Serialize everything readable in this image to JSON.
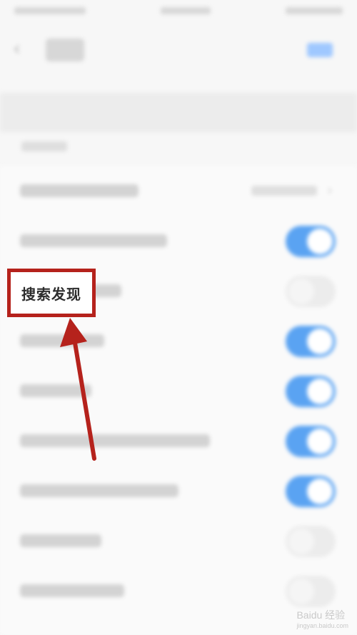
{
  "callout": {
    "label": "搜索发现"
  },
  "watermark": {
    "brand": "Baidu 经验",
    "domain": "jingyan.baidu.com"
  },
  "colors": {
    "accent": "#5aa3f2",
    "highlight": "#b5221c"
  },
  "icons": {
    "back": "chevron-left-icon",
    "row_arrow": "chevron-right-icon"
  },
  "settings": [
    {
      "type": "select"
    },
    {
      "type": "toggle",
      "on": true
    },
    {
      "type": "toggle",
      "on": false
    },
    {
      "type": "toggle",
      "on": true
    },
    {
      "type": "toggle",
      "on": true
    },
    {
      "type": "toggle",
      "on": true
    },
    {
      "type": "toggle",
      "on": true
    },
    {
      "type": "toggle",
      "on": false
    },
    {
      "type": "toggle",
      "on": false
    }
  ]
}
